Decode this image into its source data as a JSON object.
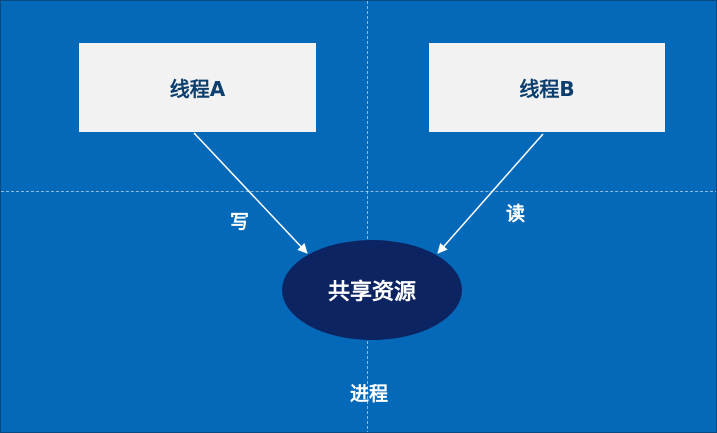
{
  "threads": {
    "a": "线程A",
    "b": "线程B"
  },
  "resource": "共享资源",
  "edges": {
    "write": "写",
    "read": "读"
  },
  "process": "进程",
  "colors": {
    "background": "#0569b9",
    "box": "#f2f2f2",
    "box_text": "#0c3e6e",
    "resource": "#0c2461",
    "text": "#ffffff"
  }
}
